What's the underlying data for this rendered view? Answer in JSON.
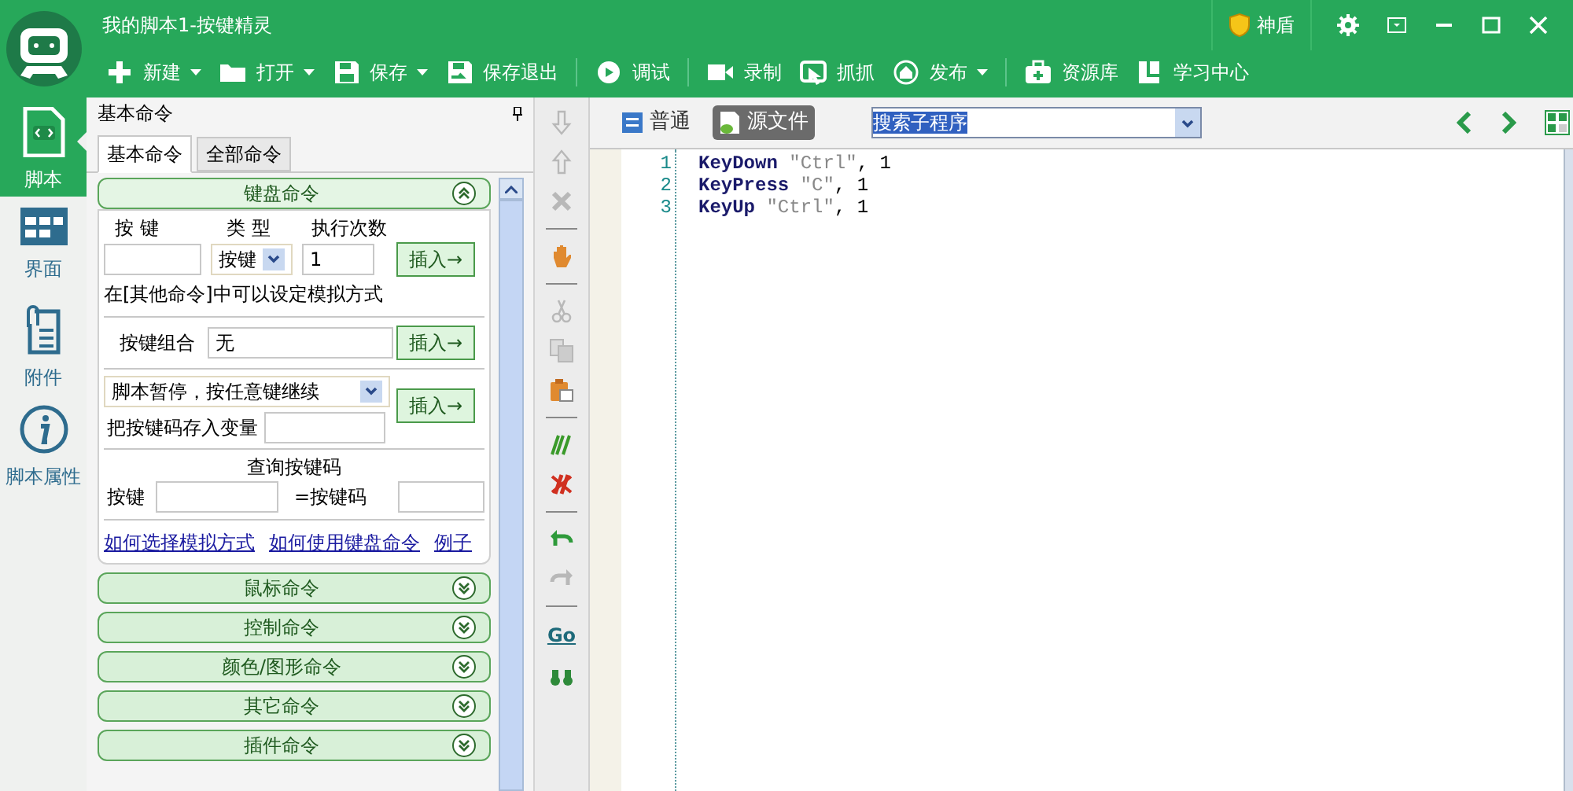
{
  "window": {
    "title": "我的脚本1-按键精灵",
    "shield": "神盾"
  },
  "toolbar": [
    {
      "kind": "new",
      "label": "新建",
      "dropdown": true
    },
    {
      "kind": "open",
      "label": "打开",
      "dropdown": true
    },
    {
      "kind": "save",
      "label": "保存",
      "dropdown": true
    },
    {
      "kind": "save-exit",
      "label": "保存退出",
      "dropdown": false
    },
    {
      "kind": "separator"
    },
    {
      "kind": "debug",
      "label": "调试",
      "dropdown": false
    },
    {
      "kind": "separator"
    },
    {
      "kind": "record",
      "label": "录制",
      "dropdown": false
    },
    {
      "kind": "capture",
      "label": "抓抓",
      "dropdown": false
    },
    {
      "kind": "publish",
      "label": "发布",
      "dropdown": true
    },
    {
      "kind": "separator"
    },
    {
      "kind": "library",
      "label": "资源库",
      "dropdown": false
    },
    {
      "kind": "learn",
      "label": "学习中心",
      "dropdown": false
    }
  ],
  "sidebar": {
    "items": [
      {
        "kind": "script",
        "label": "脚本",
        "selected": true
      },
      {
        "kind": "ui",
        "label": "界面",
        "selected": false
      },
      {
        "kind": "attach",
        "label": "附件",
        "selected": false
      },
      {
        "kind": "info",
        "label": "脚本属性",
        "selected": false
      }
    ]
  },
  "panel": {
    "title": "基本命令",
    "tabs": [
      {
        "label": "基本命令",
        "selected": true
      },
      {
        "label": "全部命令",
        "selected": false
      }
    ],
    "sections": [
      {
        "title": "键盘命令",
        "expanded": true
      },
      {
        "title": "鼠标命令",
        "expanded": false
      },
      {
        "title": "控制命令",
        "expanded": false
      },
      {
        "title": "颜色/图形命令",
        "expanded": false
      },
      {
        "title": "其它命令",
        "expanded": false
      },
      {
        "title": "插件命令",
        "expanded": false
      }
    ],
    "keyboard": {
      "key_label": "按 键",
      "type_label": "类 型",
      "count_label": "执行次数",
      "type_value": "按键",
      "count_value": "1",
      "insert": "插入→",
      "note": "在[其他命令]中可以设定模拟方式",
      "combo_label": "按键组合",
      "combo_value": "无",
      "insert2": "插入→",
      "pause_value": "脚本暂停，按任意键继续",
      "insert3": "插入→",
      "store_label": "把按键码存入变量",
      "query_title": "查询按键码",
      "query_key_label": "按键",
      "query_code_label": "=按键码",
      "links": [
        "如何选择模拟方式",
        "如何使用键盘命令",
        "例子"
      ]
    }
  },
  "vertical_toolbar": [
    {
      "kind": "down",
      "disabled": true
    },
    {
      "kind": "up",
      "disabled": true
    },
    {
      "kind": "delete",
      "disabled": true
    },
    {
      "kind": "separator"
    },
    {
      "kind": "hand",
      "disabled": false
    },
    {
      "kind": "separator"
    },
    {
      "kind": "cut",
      "disabled": true
    },
    {
      "kind": "copy",
      "disabled": true
    },
    {
      "kind": "paste",
      "disabled": false
    },
    {
      "kind": "separator"
    },
    {
      "kind": "comment",
      "disabled": false
    },
    {
      "kind": "uncomment",
      "disabled": false
    },
    {
      "kind": "separator"
    },
    {
      "kind": "undo",
      "disabled": false
    },
    {
      "kind": "redo",
      "disabled": true
    },
    {
      "kind": "separator"
    },
    {
      "kind": "go",
      "label": "Go",
      "disabled": false
    },
    {
      "kind": "find",
      "disabled": false
    }
  ],
  "editor": {
    "tabs": [
      {
        "label": "普通",
        "selected": false
      },
      {
        "label": "源文件",
        "selected": true
      }
    ],
    "search": {
      "value": "搜索子程序"
    },
    "lines": [
      {
        "number": "1",
        "tokens": [
          {
            "kind": "keyword",
            "text": "KeyDown"
          },
          {
            "kind": "string",
            "text": " \"Ctrl\""
          },
          {
            "kind": "plain",
            "text": ", 1"
          }
        ]
      },
      {
        "number": "2",
        "tokens": [
          {
            "kind": "keyword",
            "text": "KeyPress"
          },
          {
            "kind": "string",
            "text": " \"C\""
          },
          {
            "kind": "plain",
            "text": ", 1"
          }
        ]
      },
      {
        "number": "3",
        "tokens": [
          {
            "kind": "keyword",
            "text": "KeyUp"
          },
          {
            "kind": "string",
            "text": " \"Ctrl\""
          },
          {
            "kind": "plain",
            "text": ", 1"
          }
        ]
      }
    ]
  }
}
